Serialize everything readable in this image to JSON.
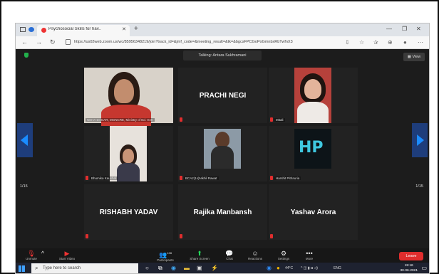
{
  "browser": {
    "tab_title": "Psychosocial Skills for hav..",
    "url": "https://us02web.zoom.us/wc/85956348219/join?track_id=&jmf_code=&meeting_result=&tk=&bgcsFPCGoPoGmnbxRbTwfnX3"
  },
  "meeting": {
    "talking": "Talking: Antara Sukhramani",
    "view_label": "View",
    "page_left": "1/15",
    "page_right": "1/15",
    "tiles": [
      {
        "caption": "NEHA DAGAR, MGNCRE, Ministry of Ed. GOI",
        "big": ""
      },
      {
        "caption": "",
        "big": "PRACHI NEGI"
      },
      {
        "caption": "Mitali",
        "big": ""
      },
      {
        "caption": "Bhumika Kaushal",
        "big": ""
      },
      {
        "caption": "BCA2(1s)Nikhil Rawat",
        "big": ""
      },
      {
        "caption": "Harshit Pithauria",
        "big": ""
      },
      {
        "caption": "",
        "big": "RISHABH YADAV"
      },
      {
        "caption": "",
        "big": "Rajika Manbansh"
      },
      {
        "caption": "",
        "big": "Yashav Arora"
      }
    ]
  },
  "toolbar": {
    "unmute": "Unmute",
    "start_video": "Start Video",
    "participants": "Participants",
    "participants_count": "128",
    "share_screen": "Share Screen",
    "chat": "Chat",
    "reactions": "Reactions",
    "settings": "Settings",
    "more": "More",
    "leave": "Leave"
  },
  "taskbar": {
    "search_placeholder": "Type here to search",
    "temperature": "44°C",
    "language": "ENG",
    "time": "15:16",
    "date": "30-06-2021"
  },
  "colors": {
    "meeting_bg": "#1c1c1c",
    "leave_red": "#e02d2d",
    "nav_arrow": "#1e3d7b",
    "share_green": "#23d959"
  }
}
